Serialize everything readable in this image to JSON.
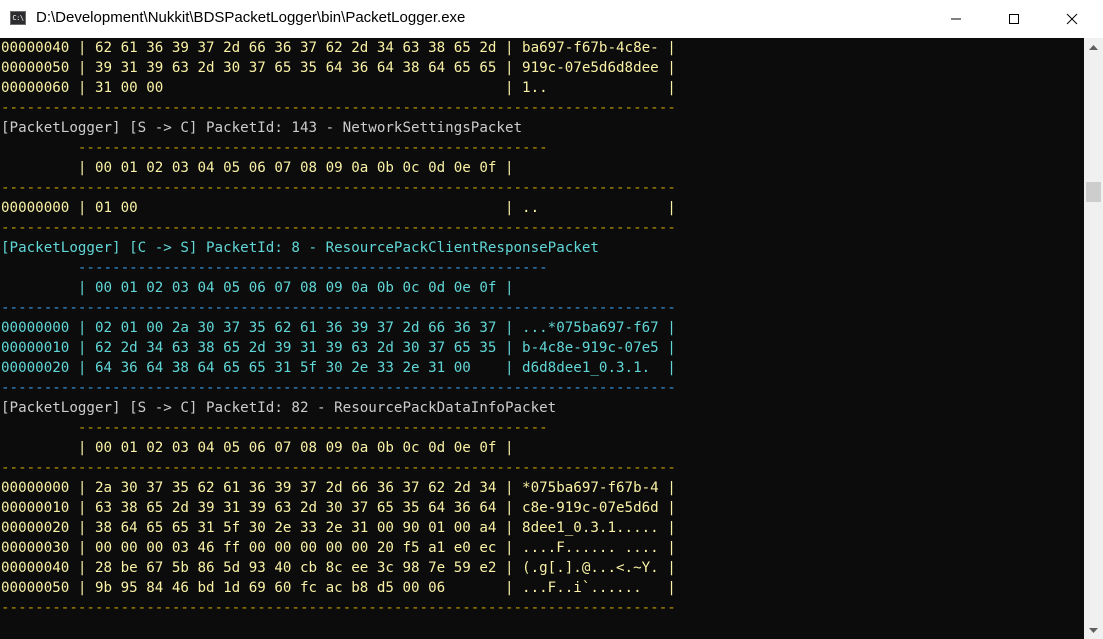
{
  "window": {
    "app_icon_text": "C:\\",
    "title": "D:\\Development\\Nukkit\\BDSPacketLogger\\bin\\PacketLogger.exe"
  },
  "console": {
    "lines": [
      {
        "text": "00000040 | 62 61 36 39 37 2d 66 36 37 62 2d 34 63 38 65 2d | ba697-f67b-4c8e- |",
        "color": "#f9f1a5"
      },
      {
        "text": "00000050 | 39 31 39 63 2d 30 37 65 35 64 36 64 38 64 65 65 | 919c-07e5d6d8dee |",
        "color": "#f9f1a5"
      },
      {
        "text": "00000060 | 31 00 00                                        | 1..              |",
        "color": "#f9f1a5"
      },
      {
        "text": "-------------------------------------------------------------------------------",
        "color": "#c19c00"
      },
      {
        "text": "[PacketLogger] [S -> C] PacketId: 143 - NetworkSettingsPacket",
        "color": "#cccccc"
      },
      {
        "text": "         -------------------------------------------------------",
        "color": "#c19c00"
      },
      {
        "text": "         | 00 01 02 03 04 05 06 07 08 09 0a 0b 0c 0d 0e 0f |",
        "color": "#f9f1a5"
      },
      {
        "text": "-------------------------------------------------------------------------------",
        "color": "#c19c00"
      },
      {
        "text": "00000000 | 01 00                                           | ..               |",
        "color": "#f9f1a5"
      },
      {
        "text": "-------------------------------------------------------------------------------",
        "color": "#c19c00"
      },
      {
        "text": "[PacketLogger] [C -> S] PacketId: 8 - ResourcePackClientResponsePacket",
        "color": "#61d6d6"
      },
      {
        "text": "         -------------------------------------------------------",
        "color": "#3a96dd"
      },
      {
        "text": "         | 00 01 02 03 04 05 06 07 08 09 0a 0b 0c 0d 0e 0f |",
        "color": "#61d6d6"
      },
      {
        "text": "-------------------------------------------------------------------------------",
        "color": "#3a96dd"
      },
      {
        "text": "00000000 | 02 01 00 2a 30 37 35 62 61 36 39 37 2d 66 36 37 | ...*075ba697-f67 |",
        "color": "#61d6d6"
      },
      {
        "text": "00000010 | 62 2d 34 63 38 65 2d 39 31 39 63 2d 30 37 65 35 | b-4c8e-919c-07e5 |",
        "color": "#61d6d6"
      },
      {
        "text": "00000020 | 64 36 64 38 64 65 65 31 5f 30 2e 33 2e 31 00    | d6d8dee1_0.3.1.  |",
        "color": "#61d6d6"
      },
      {
        "text": "-------------------------------------------------------------------------------",
        "color": "#3a96dd"
      },
      {
        "text": "[PacketLogger] [S -> C] PacketId: 82 - ResourcePackDataInfoPacket",
        "color": "#cccccc"
      },
      {
        "text": "         -------------------------------------------------------",
        "color": "#c19c00"
      },
      {
        "text": "         | 00 01 02 03 04 05 06 07 08 09 0a 0b 0c 0d 0e 0f |",
        "color": "#f9f1a5"
      },
      {
        "text": "-------------------------------------------------------------------------------",
        "color": "#c19c00"
      },
      {
        "text": "00000000 | 2a 30 37 35 62 61 36 39 37 2d 66 36 37 62 2d 34 | *075ba697-f67b-4 |",
        "color": "#f9f1a5"
      },
      {
        "text": "00000010 | 63 38 65 2d 39 31 39 63 2d 30 37 65 35 64 36 64 | c8e-919c-07e5d6d |",
        "color": "#f9f1a5"
      },
      {
        "text": "00000020 | 38 64 65 65 31 5f 30 2e 33 2e 31 00 90 01 00 a4 | 8dee1_0.3.1..... |",
        "color": "#f9f1a5"
      },
      {
        "text": "00000030 | 00 00 00 03 46 ff 00 00 00 00 00 20 f5 a1 e0 ec | ....F...... .... |",
        "color": "#f9f1a5"
      },
      {
        "text": "00000040 | 28 be 67 5b 86 5d 93 40 cb 8c ee 3c 98 7e 59 e2 | (.g[.].@...<.~Y. |",
        "color": "#f9f1a5"
      },
      {
        "text": "00000050 | 9b 95 84 46 bd 1d 69 60 fc ac b8 d5 00 06       | ...F..i`......   |",
        "color": "#f9f1a5"
      },
      {
        "text": "-------------------------------------------------------------------------------",
        "color": "#c19c00"
      }
    ]
  }
}
